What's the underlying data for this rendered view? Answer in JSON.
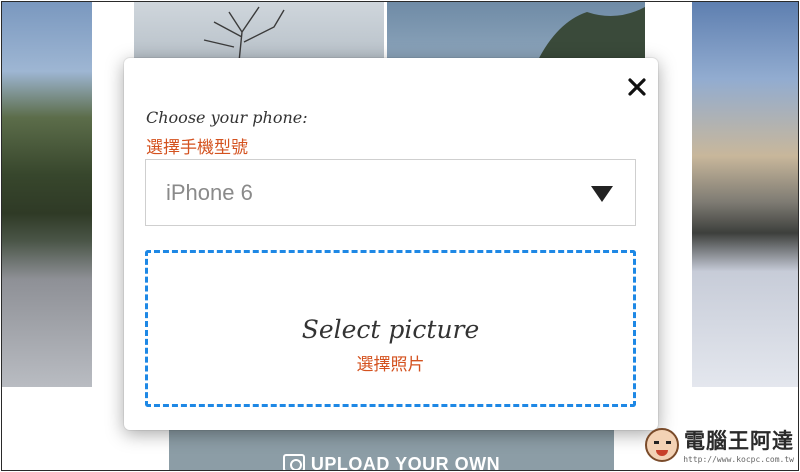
{
  "modal": {
    "close_symbol": "✕",
    "phone_label": "Choose your phone:",
    "phone_label_zh": "選擇手機型號",
    "phone_select": {
      "selected": "iPhone 6"
    },
    "dropzone": {
      "title": "Select picture",
      "subtitle_zh": "選擇照片"
    }
  },
  "upload_button": {
    "label": "UPLOAD YOUR OWN"
  },
  "watermark": {
    "title": "電腦王阿達",
    "url": "http://www.kocpc.com.tw"
  },
  "colors": {
    "accent_orange": "#d4521f",
    "dropzone_border": "#1e88e5",
    "upload_button_bg": "#8c9da6"
  },
  "icons": {
    "close": "close-icon",
    "select_caret": "caret-down-icon",
    "upload": "camera-icon"
  }
}
